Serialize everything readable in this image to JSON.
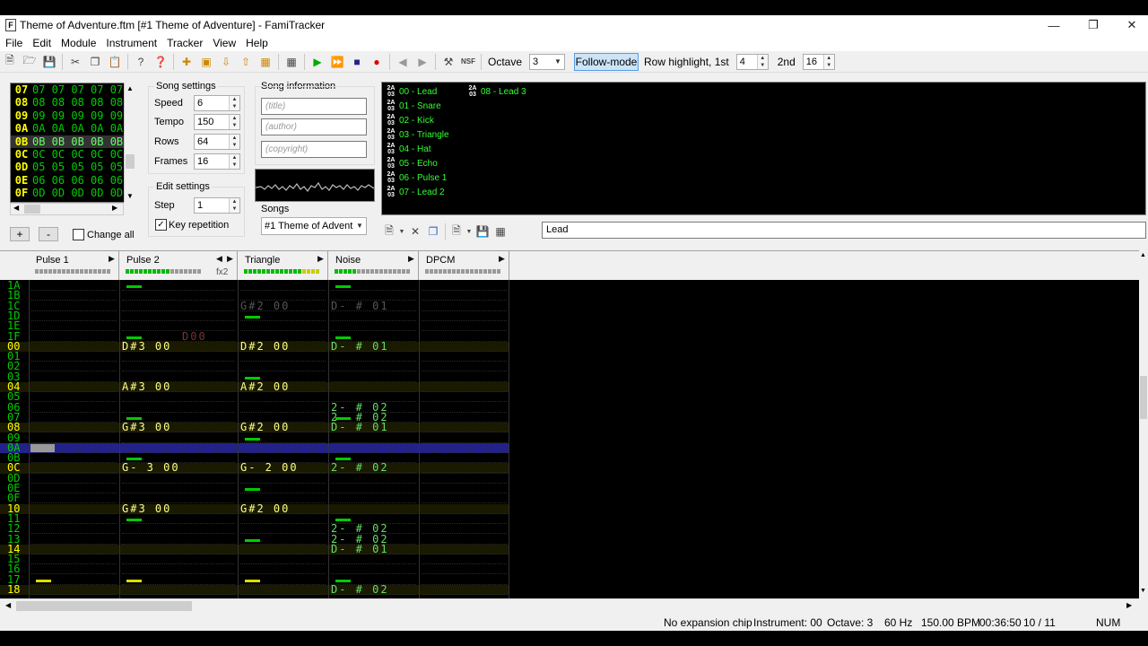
{
  "window": {
    "title": "Theme of Adventure.ftm [#1  Theme of Adventure] - FamiTracker",
    "icon": "famitracker-icon"
  },
  "menu": [
    "File",
    "Edit",
    "Module",
    "Instrument",
    "Tracker",
    "View",
    "Help"
  ],
  "toolbar": {
    "octave_label": "Octave",
    "octave_value": "3",
    "follow_mode": "Follow-mode",
    "row_highlight_label": "Row highlight, 1st",
    "row_highlight_1st": "4",
    "second_label": "2nd",
    "row_highlight_2nd": "16"
  },
  "frames": {
    "rows": [
      {
        "idx": "07",
        "cells": "07 07 07 07 07"
      },
      {
        "idx": "08",
        "cells": "08 08 08 08 08"
      },
      {
        "idx": "09",
        "cells": "09 09 09 09 09"
      },
      {
        "idx": "0A",
        "cells": "0A 0A 0A 0A 0A"
      },
      {
        "idx": "0B",
        "cells": "0B 0B 0B 0B 0B",
        "selected": true
      },
      {
        "idx": "0C",
        "cells": "0C 0C 0C 0C 0C"
      },
      {
        "idx": "0D",
        "cells": "05 05 05 05 05"
      },
      {
        "idx": "0E",
        "cells": "06 06 06 06 06"
      },
      {
        "idx": "0F",
        "cells": "0D 0D 0D 0D 0D"
      }
    ],
    "add": "+",
    "remove": "-",
    "change_all": "Change all"
  },
  "song_settings": {
    "title": "Song settings",
    "speed_label": "Speed",
    "speed": "6",
    "tempo_label": "Tempo",
    "tempo": "150",
    "rows_label": "Rows",
    "rows": "64",
    "frames_label": "Frames",
    "frames": "16"
  },
  "edit_settings": {
    "title": "Edit settings",
    "step_label": "Step",
    "step": "1",
    "key_repetition": "Key repetition"
  },
  "song_info": {
    "title": "Song information",
    "title_ph": "(title)",
    "author_ph": "(author)",
    "copyright_ph": "(copyright)"
  },
  "songs": {
    "label": "Songs",
    "selected": "#1 Theme of Advent"
  },
  "instruments": [
    {
      "badge": "2A 03",
      "name": "00 - Lead"
    },
    {
      "badge": "2A 03",
      "name": "01 - Snare"
    },
    {
      "badge": "2A 03",
      "name": "02 - Kick"
    },
    {
      "badge": "2A 03",
      "name": "03 - Triangle"
    },
    {
      "badge": "2A 03",
      "name": "04 - Hat"
    },
    {
      "badge": "2A 03",
      "name": "05 - Echo"
    },
    {
      "badge": "2A 03",
      "name": "06 - Pulse 1"
    },
    {
      "badge": "2A 03",
      "name": "07 - Lead 2"
    },
    {
      "badge": "2A 03",
      "name": "08 - Lead 3"
    }
  ],
  "instrument_name": "Lead",
  "channels": [
    {
      "name": "Pulse 1",
      "extra": ""
    },
    {
      "name": "Pulse 2",
      "extra": "fx2"
    },
    {
      "name": "Triangle",
      "extra": ""
    },
    {
      "name": "Noise",
      "extra": ""
    },
    {
      "name": "DPCM",
      "extra": ""
    }
  ],
  "pattern": {
    "rows": [
      {
        "n": "1A",
        "c": [
          "",
          "",
          "",
          "",
          ""
        ]
      },
      {
        "n": "1B",
        "c": [
          "",
          "",
          "",
          "",
          ""
        ]
      },
      {
        "n": "1C",
        "c": [
          "",
          "",
          "G#2 00",
          "D- # 01",
          ""
        ],
        "dim": [
          2,
          3
        ]
      },
      {
        "n": "1D",
        "c": [
          "",
          "",
          "",
          "",
          ""
        ]
      },
      {
        "n": "1E",
        "c": [
          "",
          "",
          "",
          "",
          ""
        ]
      },
      {
        "n": "1F",
        "c": [
          "",
          "D00",
          "",
          "",
          ""
        ]
      },
      {
        "n": "00",
        "c": [
          "",
          "D#3 00",
          "D#2 00",
          "D- # 01",
          ""
        ],
        "hl": true
      },
      {
        "n": "01",
        "c": [
          "",
          "",
          "",
          "",
          ""
        ]
      },
      {
        "n": "02",
        "c": [
          "",
          "",
          "",
          "",
          ""
        ]
      },
      {
        "n": "03",
        "c": [
          "",
          "",
          "",
          "",
          ""
        ]
      },
      {
        "n": "04",
        "c": [
          "",
          "A#3 00",
          "A#2 00",
          "",
          ""
        ],
        "hl": true
      },
      {
        "n": "05",
        "c": [
          "",
          "",
          "",
          "",
          ""
        ]
      },
      {
        "n": "06",
        "c": [
          "",
          "",
          "",
          "2- # 02",
          ""
        ]
      },
      {
        "n": "07",
        "c": [
          "",
          "",
          "",
          "2- # 02",
          ""
        ]
      },
      {
        "n": "08",
        "c": [
          "",
          "G#3 00",
          "G#2 00",
          "D- # 01",
          ""
        ],
        "hl": true
      },
      {
        "n": "09",
        "c": [
          "",
          "",
          "",
          "",
          ""
        ]
      },
      {
        "n": "0A",
        "c": [
          "",
          "",
          "",
          "",
          ""
        ],
        "cur": true
      },
      {
        "n": "0B",
        "c": [
          "",
          "",
          "",
          "",
          ""
        ]
      },
      {
        "n": "0C",
        "c": [
          "",
          "G- 3 00",
          "G- 2 00",
          "2- # 02",
          ""
        ],
        "hl": true
      },
      {
        "n": "0D",
        "c": [
          "",
          "",
          "",
          "",
          ""
        ]
      },
      {
        "n": "0E",
        "c": [
          "",
          "",
          "",
          "",
          ""
        ]
      },
      {
        "n": "0F",
        "c": [
          "",
          "",
          "",
          "",
          ""
        ]
      },
      {
        "n": "10",
        "c": [
          "",
          "G#3 00",
          "G#2 00",
          "",
          ""
        ],
        "hl": true
      },
      {
        "n": "11",
        "c": [
          "",
          "",
          "",
          "",
          ""
        ]
      },
      {
        "n": "12",
        "c": [
          "",
          "",
          "",
          "2- # 02",
          ""
        ]
      },
      {
        "n": "13",
        "c": [
          "",
          "",
          "",
          "2- # 02",
          ""
        ]
      },
      {
        "n": "14",
        "c": [
          "",
          "",
          "",
          "D- # 01",
          ""
        ],
        "hl": true
      },
      {
        "n": "15",
        "c": [
          "",
          "",
          "",
          "",
          ""
        ]
      },
      {
        "n": "16",
        "c": [
          "",
          "",
          "",
          "",
          ""
        ]
      },
      {
        "n": "17",
        "c": [
          "",
          "",
          "",
          "",
          ""
        ]
      },
      {
        "n": "18",
        "c": [
          "",
          "",
          "",
          "D- # 02",
          ""
        ],
        "hl": true
      }
    ]
  },
  "status": {
    "chip": "No expansion chip",
    "instrument": "Instrument: 00",
    "octave": "Octave: 3",
    "rate": "60 Hz",
    "bpm": "150.00 BPM",
    "time": "00:36:50",
    "position": "10 / 11",
    "num": "NUM"
  }
}
